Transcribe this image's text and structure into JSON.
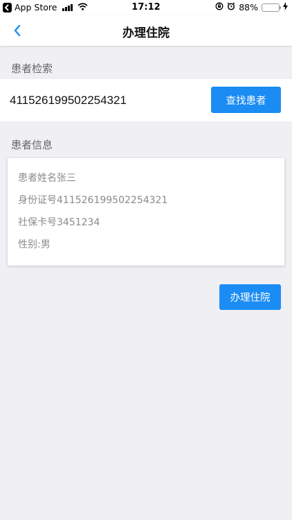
{
  "status_bar": {
    "back_app": "App Store",
    "time": "17:12",
    "battery": "88%",
    "battery_level": 0.88
  },
  "nav": {
    "title": "办理住院"
  },
  "search_section": {
    "label": "患者检索",
    "input_value": "411526199502254321",
    "button_label": "查找患者"
  },
  "info_section": {
    "label": "患者信息",
    "lines": [
      "患者姓名张三",
      "身份证号411526199502254321",
      "社保卡号3451234",
      "性别:男"
    ]
  },
  "actions": {
    "admit_label": "办理住院"
  },
  "colors": {
    "accent": "#1a8cf4",
    "background": "#efeff4",
    "battery_green": "#4cd964"
  },
  "icons": [
    "back-to-app-icon",
    "signal-icon",
    "wifi-icon",
    "screen-lock-icon",
    "alarm-icon",
    "battery-icon",
    "charging-icon",
    "back-chevron-icon"
  ]
}
